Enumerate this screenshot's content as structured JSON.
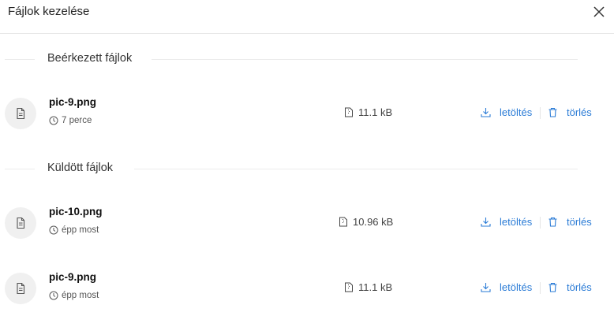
{
  "dialog": {
    "title": "Fájlok kezelése",
    "close_icon": "close-icon"
  },
  "sections": {
    "received": {
      "label": "Beérkezett fájlok",
      "files": [
        {
          "name": "pic-9.png",
          "time": "7 perce",
          "size": "11.1 kB",
          "download_label": "letöltés",
          "delete_label": "törlés"
        }
      ]
    },
    "sent": {
      "label": "Küldött fájlok",
      "files": [
        {
          "name": "pic-10.png",
          "time": "épp most",
          "size": "10.96 kB",
          "download_label": "letöltés",
          "delete_label": "törlés"
        },
        {
          "name": "pic-9.png",
          "time": "épp most",
          "size": "11.1 kB",
          "download_label": "letöltés",
          "delete_label": "törlés"
        }
      ]
    }
  },
  "colors": {
    "accent": "#2a7bd6",
    "icon_bg": "#f0f0f0",
    "divider": "#ececec"
  }
}
